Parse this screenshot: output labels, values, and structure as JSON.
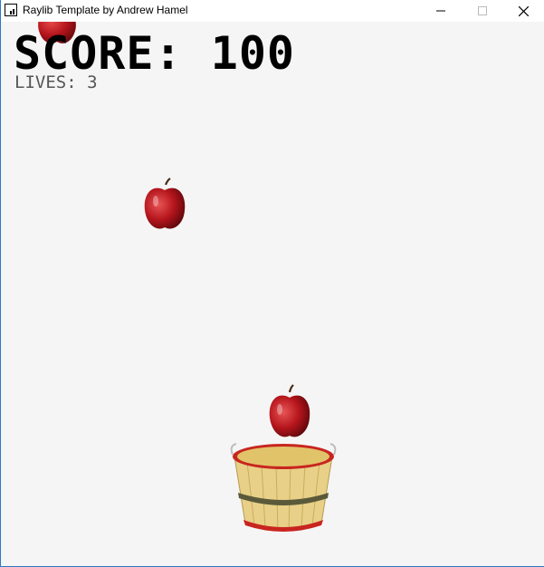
{
  "window": {
    "title": "Raylib Template by Andrew Hamel",
    "controls": [
      "minimize-icon",
      "maximize-icon",
      "close-icon"
    ]
  },
  "hud": {
    "score_text": "SCORE: 100",
    "lives_text": "LIVES: 3"
  },
  "colors": {
    "background": "#f5f5f5",
    "apple_red": "#c4161c",
    "basket_rim": "#c8251f",
    "basket_wood": "#e6cf7f"
  },
  "sprites": [
    "apple",
    "apple",
    "apple",
    "basket"
  ]
}
